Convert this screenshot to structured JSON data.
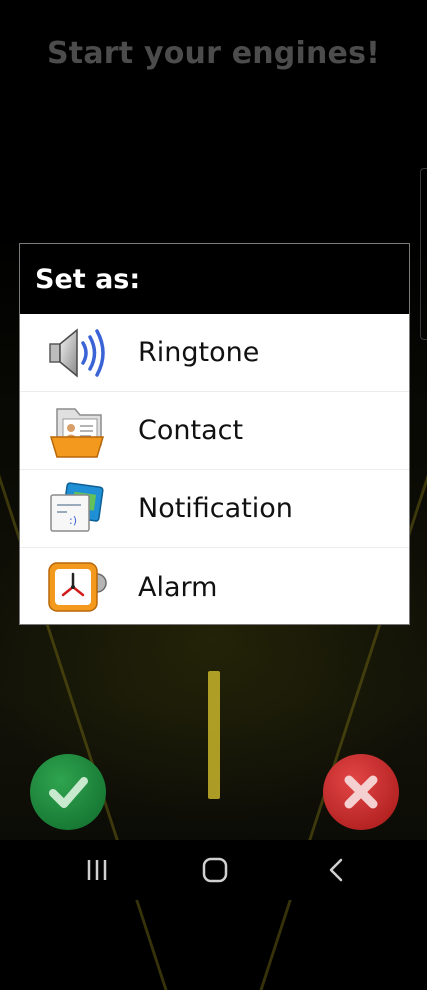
{
  "screen": {
    "headline": "Start your engines!"
  },
  "dialog": {
    "title": "Set as:",
    "options": [
      {
        "label": "Ringtone",
        "icon": "speaker-volume-icon"
      },
      {
        "label": "Contact",
        "icon": "contact-card-folder-icon"
      },
      {
        "label": "Notification",
        "icon": "message-envelope-icon"
      },
      {
        "label": "Alarm",
        "icon": "alarm-clock-icon"
      }
    ]
  },
  "actions": {
    "confirm_icon": "checkmark-icon",
    "cancel_icon": "close-x-icon"
  },
  "navigation": {
    "recents_icon": "recents-icon",
    "home_icon": "home-icon",
    "back_icon": "back-icon"
  },
  "colors": {
    "confirm": "#1f8a3d",
    "cancel": "#d12b2b",
    "lane_line": "#c8b52a"
  }
}
